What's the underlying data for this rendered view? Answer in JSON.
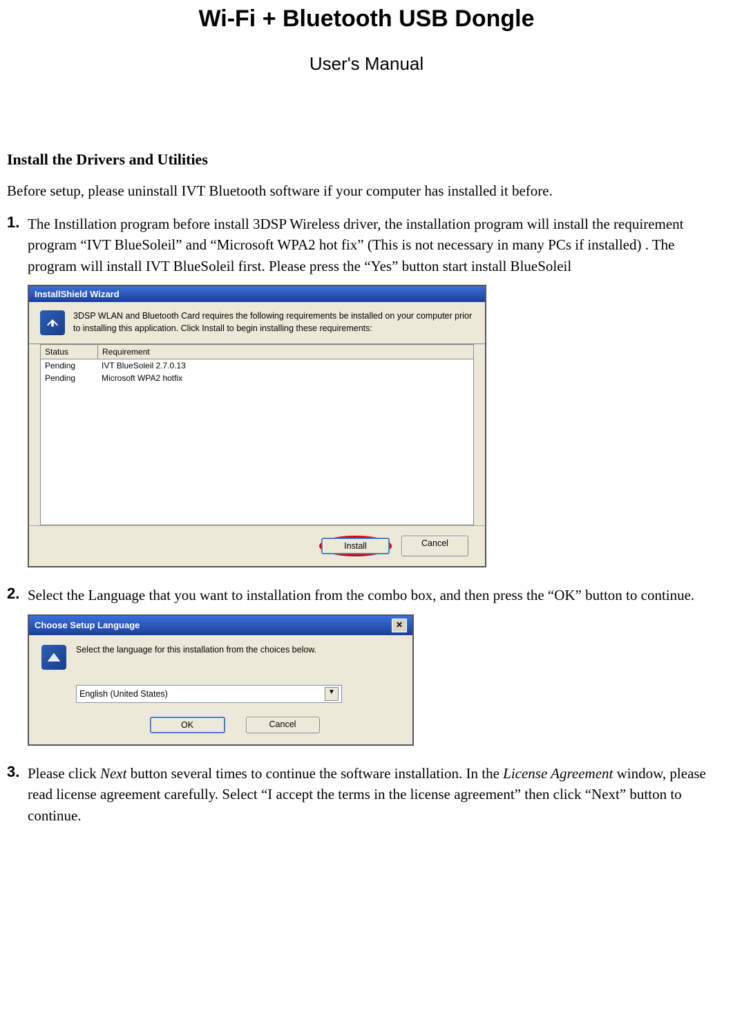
{
  "title": "Wi-Fi + Bluetooth USB Dongle",
  "subtitle": "User's Manual",
  "section_heading": "Install the Drivers and Utilities",
  "intro": "Before setup, please uninstall IVT Bluetooth software if your computer has installed it before.",
  "steps": {
    "s1": {
      "num": "1.",
      "text": "The Instillation program before install 3DSP Wireless driver, the installation program will install the requirement program “IVT BlueSoleil” and “Microsoft WPA2 hot fix” (This is not necessary in many PCs if installed) . The program will install IVT BlueSoleil first. Please press the “Yes” button start install BlueSoleil"
    },
    "s2": {
      "num": "2.",
      "text": "Select the Language that you want to installation from the combo box, and then press the “OK” button to continue."
    },
    "s3": {
      "num": "3.",
      "text_a": "Please click ",
      "text_b": "Next",
      "text_c": " button several times to continue the software installation. In the ",
      "text_d": "License Agreement",
      "text_e": " window, please read license agreement carefully. Select “I accept the terms in the license agreement” then click “Next” button to continue."
    }
  },
  "wizard1": {
    "title": "InstallShield Wizard",
    "desc": "3DSP WLAN and Bluetooth Card requires the following requirements be installed on your computer prior to installing this application. Click Install to begin installing these requirements:",
    "headers": {
      "status": "Status",
      "req": "Requirement"
    },
    "rows": [
      {
        "status": "Pending",
        "req": "IVT BlueSoleil 2.7.0.13"
      },
      {
        "status": "Pending",
        "req": "Microsoft WPA2 hotfix"
      }
    ],
    "install": "Install",
    "cancel": "Cancel"
  },
  "lang": {
    "title": "Choose Setup Language",
    "desc": "Select the language for this installation from the choices below.",
    "selected": "English (United States)",
    "ok": "OK",
    "cancel": "Cancel"
  }
}
